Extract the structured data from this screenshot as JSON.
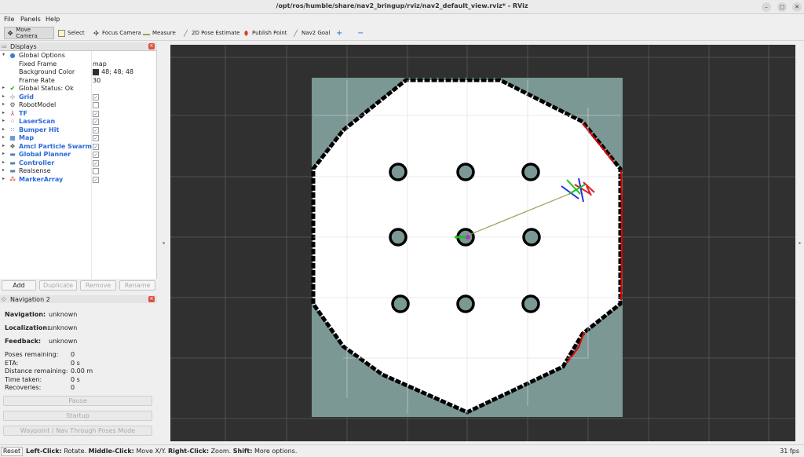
{
  "window": {
    "title": "/opt/ros/humble/share/nav2_bringup/rviz/nav2_default_view.rviz* - RViz",
    "buttons": [
      "–",
      "□",
      "✕"
    ]
  },
  "menu": [
    "File",
    "Panels",
    "Help"
  ],
  "toolbar": {
    "tools": [
      {
        "label": "Move Camera",
        "icon": "move-camera-icon"
      },
      {
        "label": "Select",
        "icon": "select-icon"
      },
      {
        "label": "Focus Camera",
        "icon": "focus-camera-icon"
      },
      {
        "label": "Measure",
        "icon": "measure-icon"
      },
      {
        "label": "2D Pose Estimate",
        "icon": "pose-estimate-icon"
      },
      {
        "label": "Publish Point",
        "icon": "publish-point-icon"
      },
      {
        "label": "Nav2 Goal",
        "icon": "nav2-goal-icon"
      }
    ],
    "plus_icon": "+",
    "minus_icon": "−"
  },
  "displays": {
    "title": "Displays",
    "rows": [
      {
        "label": "Global Options",
        "icon": "●"
      },
      {
        "label": "Fixed Frame",
        "value": "map"
      },
      {
        "label": "Background Color",
        "value": "48; 48; 48"
      },
      {
        "label": "Frame Rate",
        "value": "30"
      },
      {
        "label": "Global Status: Ok",
        "icon": "✔"
      },
      {
        "label": "Grid",
        "checked": true
      },
      {
        "label": "RobotModel",
        "checked": false
      },
      {
        "label": "TF",
        "checked": true
      },
      {
        "label": "LaserScan",
        "checked": true
      },
      {
        "label": "Bumper Hit",
        "checked": true
      },
      {
        "label": "Map",
        "checked": true
      },
      {
        "label": "Amcl Particle Swarm",
        "checked": true
      },
      {
        "label": "Global Planner",
        "checked": true
      },
      {
        "label": "Controller",
        "checked": true
      },
      {
        "label": "Realsense",
        "checked": false
      },
      {
        "label": "MarkerArray",
        "checked": true
      }
    ],
    "buttons": {
      "add": "Add",
      "duplicate": "Duplicate",
      "remove": "Remove",
      "rename": "Rename"
    }
  },
  "navigation": {
    "title": "Navigation 2",
    "navigation_label": "Navigation:",
    "navigation_value": "unknown",
    "localization_label": "Localization:",
    "localization_value": "unknown",
    "feedback_label": "Feedback:",
    "feedback_value": "unknown",
    "poses_remaining_label": "Poses remaining:",
    "poses_remaining_value": "0",
    "eta_label": "ETA:",
    "eta_value": "0 s",
    "distance_label": "Distance remaining:",
    "distance_value": "0.00 m",
    "time_label": "Time taken:",
    "time_value": "0 s",
    "recoveries_label": "Recoveries:",
    "recoveries_value": "0",
    "pause": "Pause",
    "startup": "Startup",
    "waypoint": "Waypoint / Nav Through Poses Mode"
  },
  "status": {
    "reset": "Reset",
    "left_click": "Left-Click:",
    "left_text": "Rotate.",
    "middle_click": "Middle-Click:",
    "middle_text": "Move X/Y.",
    "right_click": "Right-Click:",
    "right_text": "Zoom.",
    "shift": "Shift:",
    "shift_text": "More options.",
    "fps": "31 fps"
  },
  "colors": {
    "background": "#303030",
    "map_unknown": "#7b9895",
    "map_free": "#ffffff",
    "map_wall": "#000000",
    "laser": "#e00000",
    "plan": "#9aa060",
    "accent_blue": "#2a6ad8"
  }
}
